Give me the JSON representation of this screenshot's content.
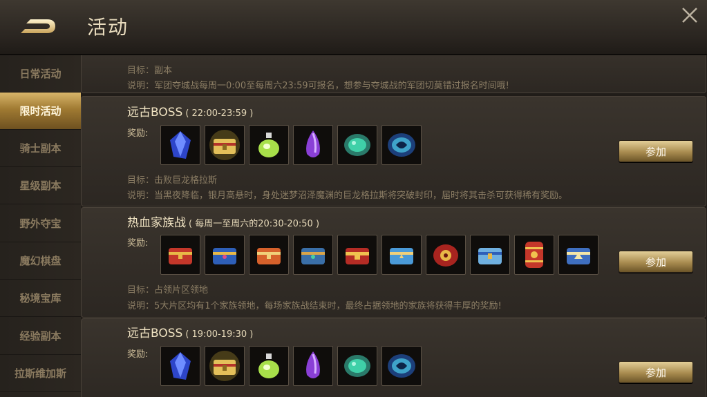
{
  "header": {
    "title": "活动"
  },
  "sidebar": {
    "items": [
      {
        "label": "日常活动",
        "active": false
      },
      {
        "label": "限时活动",
        "active": true
      },
      {
        "label": "骑士副本",
        "active": false
      },
      {
        "label": "星级副本",
        "active": false
      },
      {
        "label": "野外夺宝",
        "active": false
      },
      {
        "label": "魔幻棋盘",
        "active": false
      },
      {
        "label": "秘境宝库",
        "active": false
      },
      {
        "label": "经验副本",
        "active": false
      },
      {
        "label": "拉斯维加斯",
        "active": false
      }
    ]
  },
  "top_panel": {
    "target": "目标：副本",
    "desc": "说明：军团夺城战每周一0:00至每周六23:59可报名，想参与夺城战的军团切莫错过报名时间哦!"
  },
  "events": [
    {
      "title": "远古BOSS",
      "time": "( 22:00-23:59 )",
      "reward_label": "奖励:",
      "rewards": [
        "blue-crystal-icon",
        "golden-chest-icon",
        "green-potion-icon",
        "purple-gem-icon",
        "emerald-stone-icon",
        "blue-rune-stone-icon"
      ],
      "target": "目标：击败巨龙格拉斯",
      "desc": "说明：当黑夜降临，银月高悬时，身处迷梦沼泽魔渊的巨龙格拉斯将突破封印，届时将其击杀可获得稀有奖励。",
      "button": "参加"
    },
    {
      "title": "热血家族战",
      "time": "( 每周一至周六的20:30-20:50 )",
      "reward_label": "奖励:",
      "rewards": [
        "red-chest-icon",
        "blue-chest-icon",
        "orange-chest-icon",
        "teal-chest-icon",
        "red-gold-chest-icon",
        "sky-chest-icon",
        "red-round-chest-icon",
        "blue-gold-chest-icon",
        "red-barrel-chest-icon",
        "white-gold-chest-icon"
      ],
      "target": "目标：占领片区领地",
      "desc": "说明：5大片区均有1个家族领地，每场家族战结束时，最终占据领地的家族将获得丰厚的奖励!",
      "button": "参加"
    },
    {
      "title": "远古BOSS",
      "time": "( 19:00-19:30 )",
      "reward_label": "奖励:",
      "rewards": [
        "blue-crystal-icon",
        "golden-chest-icon",
        "green-potion-icon",
        "purple-gem-icon",
        "emerald-stone-icon",
        "blue-rune-stone-icon"
      ],
      "button": "参加"
    }
  ],
  "colors": {
    "accent_gold": "#d8b56a",
    "panel_bg": "#3a342d",
    "text": "#d8c9a6"
  }
}
